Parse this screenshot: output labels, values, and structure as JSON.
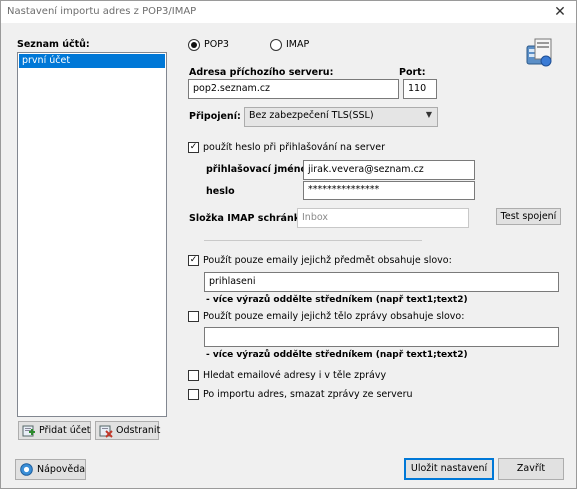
{
  "window": {
    "title": "Nastavení importu adres z POP3/IMAP",
    "close_glyph": "✕"
  },
  "accounts": {
    "label": "Seznam účtů:",
    "items": [
      "první účet"
    ]
  },
  "protocol": {
    "pop3_label": "POP3",
    "imap_label": "IMAP",
    "selected": "POP3"
  },
  "server": {
    "address_label": "Adresa příchozího serveru:",
    "address_value": "pop2.seznam.cz",
    "port_label": "Port:",
    "port_value": "110"
  },
  "connection": {
    "label": "Připojení:",
    "value": "Bez zabezpečení TLS(SSL)"
  },
  "auth": {
    "use_password_label": "použít heslo při přihlašování na server",
    "use_password_checked": true,
    "login_label": "přihlašovací jméno",
    "login_value": "jirak.vevera@seznam.cz",
    "password_label": "heslo",
    "password_value": "***************"
  },
  "imap_folder": {
    "label": "Složka IMAP schránky",
    "placeholder": "Inbox",
    "test_button": "Test spojení"
  },
  "filter_subject": {
    "label": "Použít pouze emaily jejichž předmět obsahuje slovo:",
    "checked": true,
    "value": "prihlaseni",
    "hint": "- více výrazů oddělte středníkem (např text1;text2)"
  },
  "filter_body": {
    "label": "Použít pouze emaily jejichž tělo zprávy obsahuje slovo:",
    "checked": false,
    "value": "",
    "hint": "- více výrazů oddělte středníkem (např text1;text2)"
  },
  "options": {
    "search_body_label": "Hledat emailové adresy i v těle zprávy",
    "search_body_checked": false,
    "delete_after_label": "Po importu adres, smazat zprávy ze serveru",
    "delete_after_checked": false
  },
  "buttons": {
    "add_account": "Přidat účet",
    "remove_account": "Odstranit",
    "help": "Nápověda",
    "save": "Uložit nastavení",
    "close": "Zavřít"
  },
  "icons": {
    "app": "mail-server-icon",
    "add": "add-account-icon",
    "remove": "remove-account-icon",
    "help": "help-icon"
  },
  "colors": {
    "selection": "#0078d7",
    "dialog_bg": "#f0f0f0"
  }
}
